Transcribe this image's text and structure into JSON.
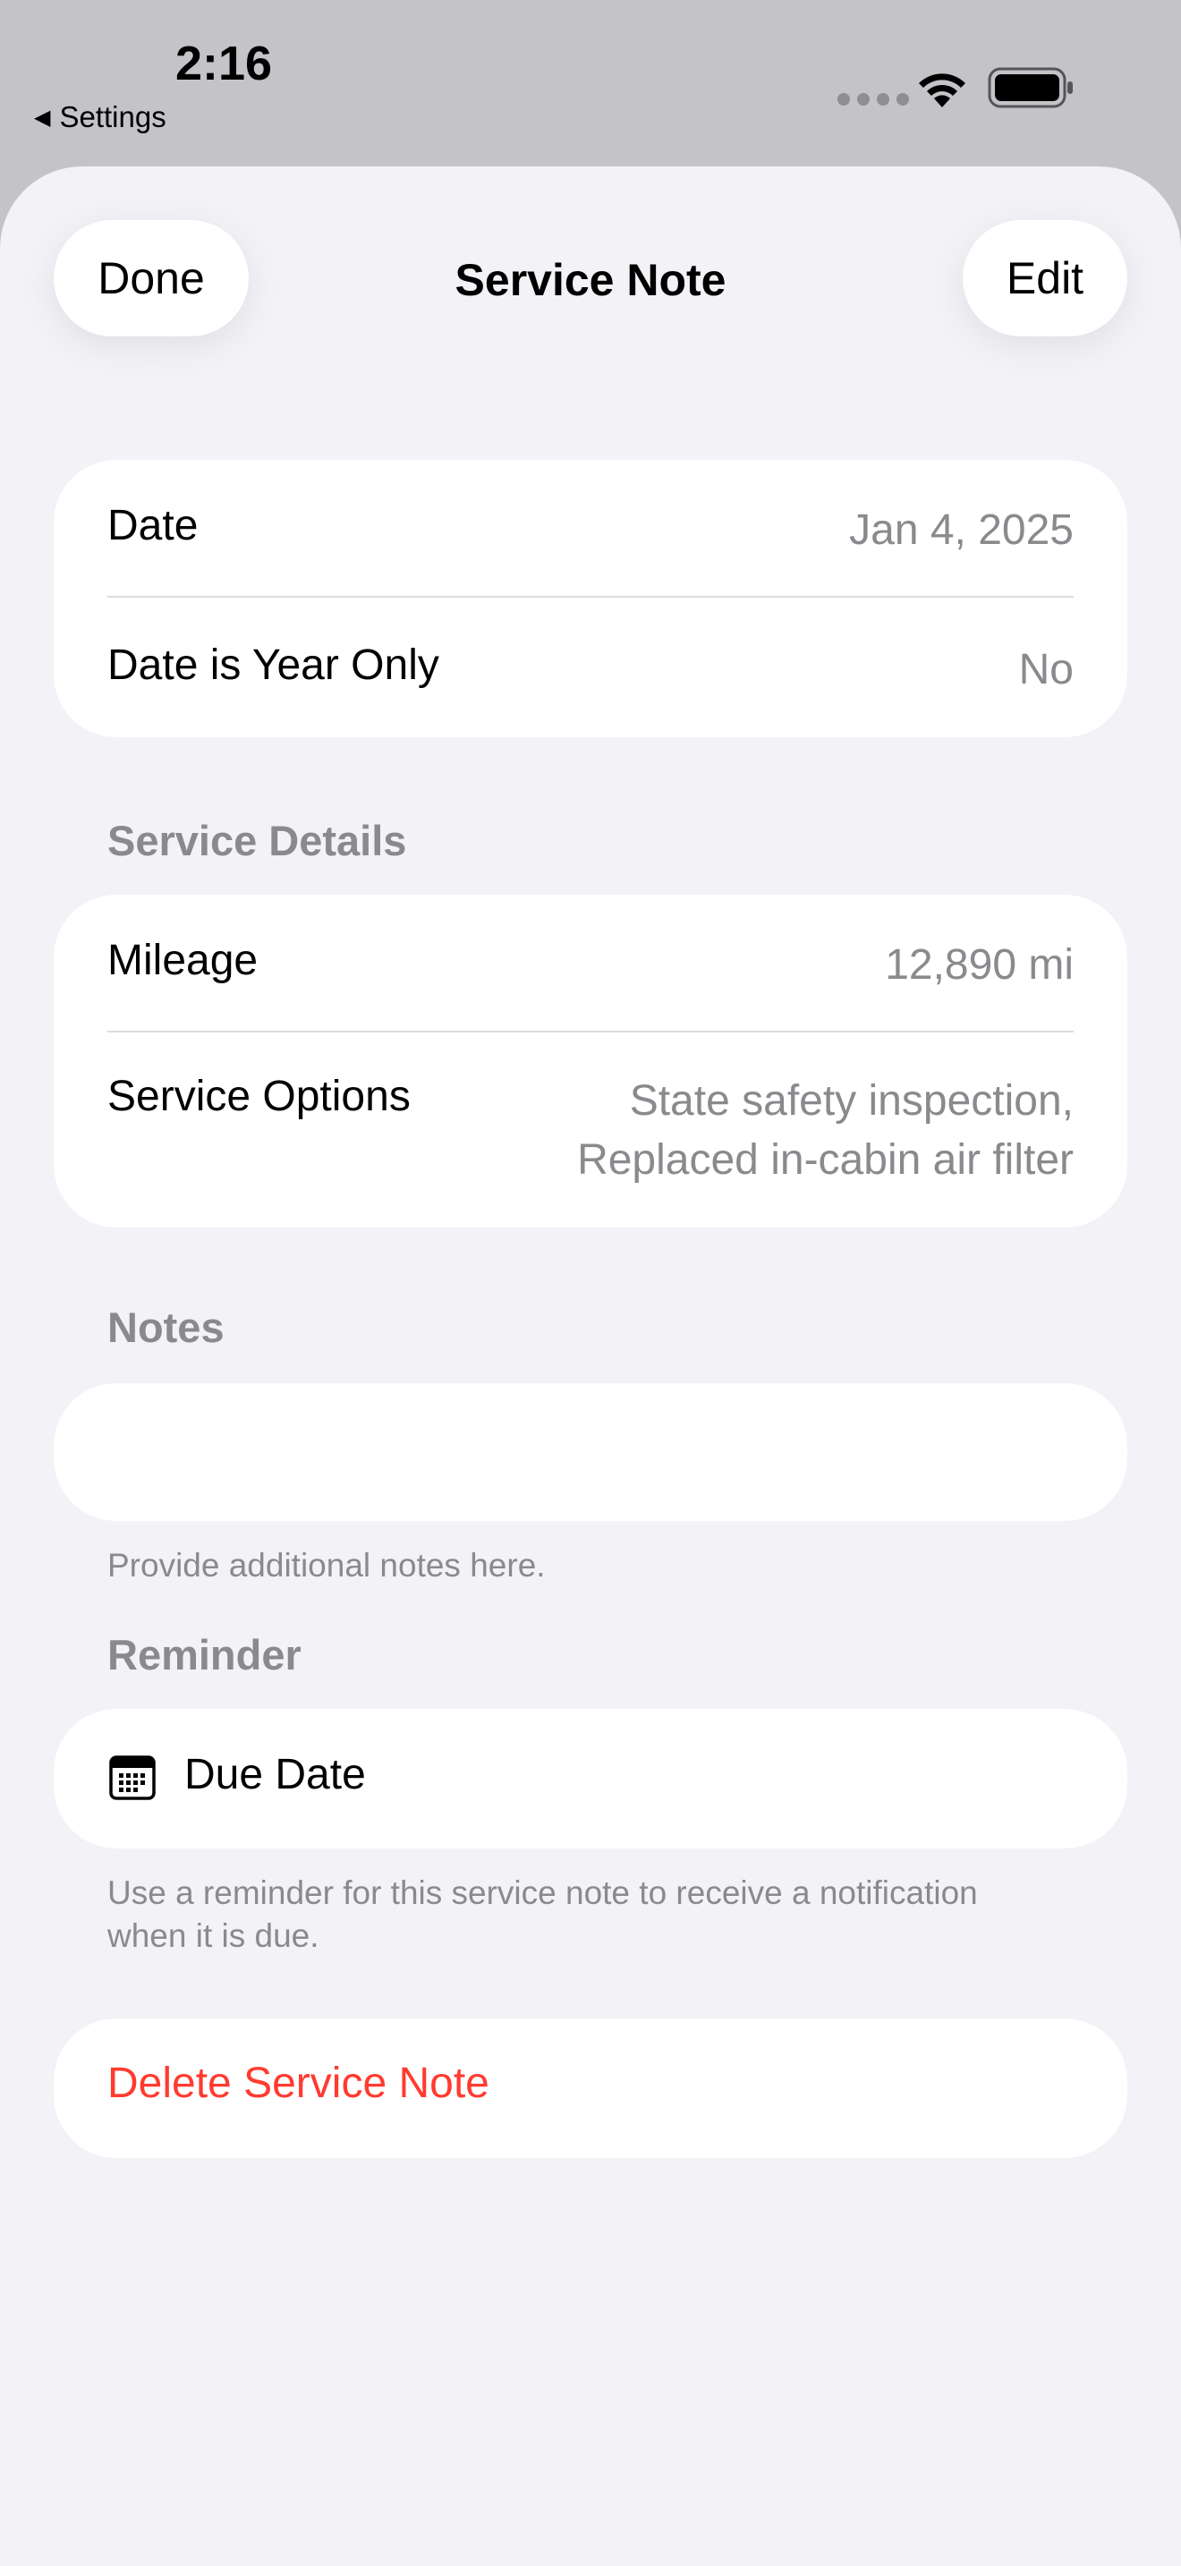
{
  "status_bar": {
    "time": "2:16",
    "back_app": "Settings",
    "back_arrow": "◀",
    "wifi_icon": "wifi-icon",
    "battery_icon": "battery-icon"
  },
  "nav": {
    "done_label": "Done",
    "title": "Service Note",
    "edit_label": "Edit"
  },
  "date_card": {
    "date_label": "Date",
    "date_value": "Jan 4, 2025",
    "year_only_label": "Date is Year Only",
    "year_only_value": "No"
  },
  "service_details": {
    "header": "Service Details",
    "mileage_label": "Mileage",
    "mileage_value": "12,890 mi",
    "options_label": "Service Options",
    "options_value_line1": "State safety inspection,",
    "options_value_line2": "Replaced in-cabin air filter"
  },
  "notes": {
    "header": "Notes",
    "value": "",
    "footer": "Provide additional notes here."
  },
  "reminder": {
    "header": "Reminder",
    "due_date_label": "Due Date",
    "icon": "calendar-icon",
    "footer": "Use a reminder for this service note to receive a notification when it is due."
  },
  "delete": {
    "label": "Delete Service Note",
    "color": "#ff3b30"
  },
  "colors": {
    "background": "#f2f2f7",
    "card": "#ffffff",
    "secondary_text": "#8a8a8e",
    "status_bar_bg": "#c3c3c8"
  }
}
